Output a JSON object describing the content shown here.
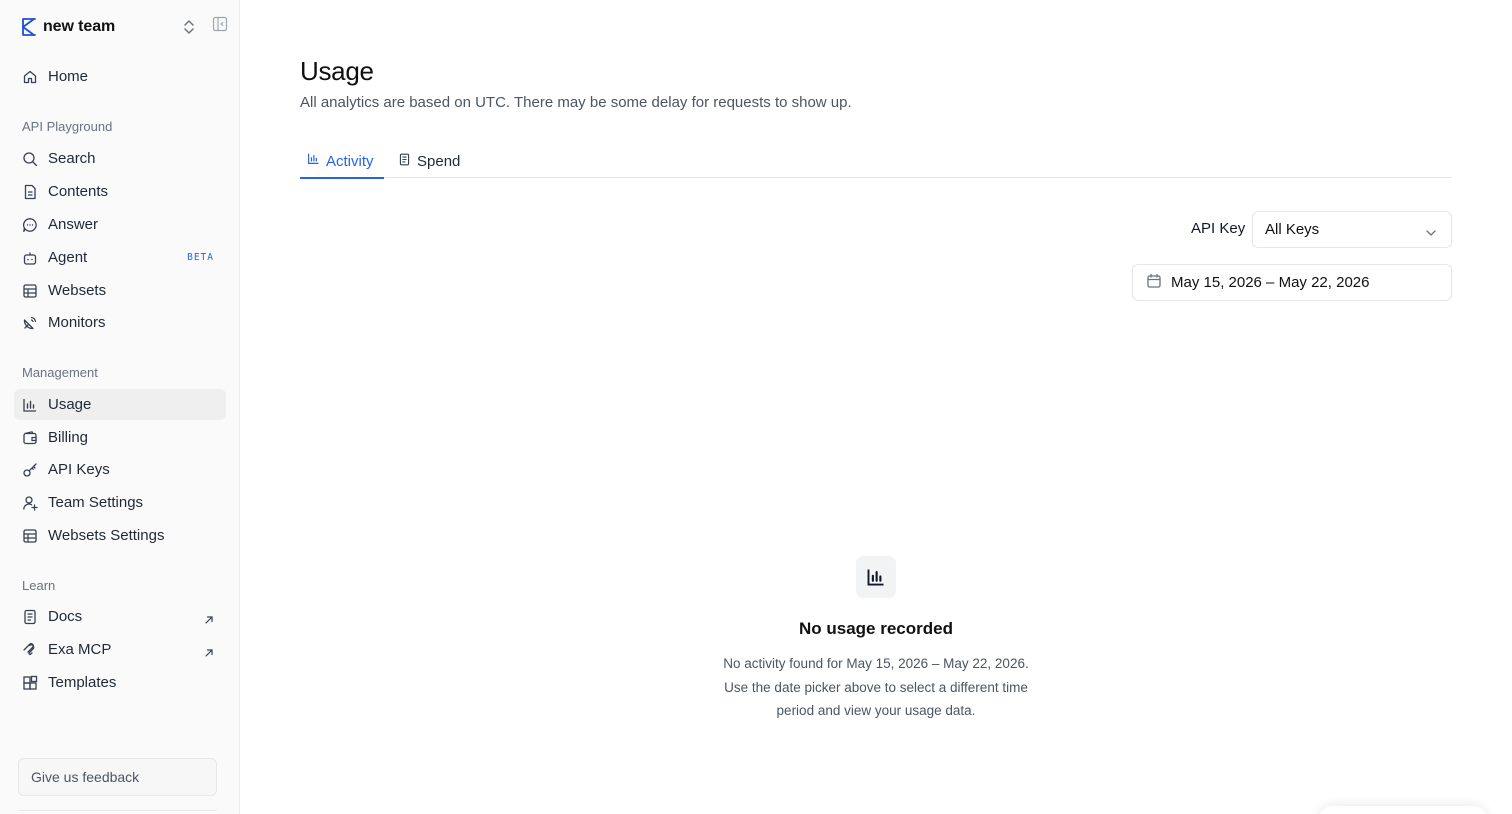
{
  "team": {
    "name": "new team"
  },
  "sidebar": {
    "home": {
      "label": "Home"
    },
    "sections": {
      "api_playground": "API Playground",
      "management": "Management",
      "learn": "Learn"
    },
    "api_items": [
      {
        "label": "Search"
      },
      {
        "label": "Contents"
      },
      {
        "label": "Answer"
      },
      {
        "label": "Agent",
        "badge": "BETA"
      },
      {
        "label": "Websets"
      },
      {
        "label": "Monitors"
      }
    ],
    "management_items": [
      {
        "label": "Usage",
        "active": true
      },
      {
        "label": "Billing"
      },
      {
        "label": "API Keys"
      },
      {
        "label": "Team Settings"
      },
      {
        "label": "Websets Settings"
      }
    ],
    "learn_items": [
      {
        "label": "Docs",
        "external": true
      },
      {
        "label": "Exa MCP",
        "external": true
      },
      {
        "label": "Templates"
      }
    ],
    "feedback_label": "Give us feedback"
  },
  "main": {
    "title": "Usage",
    "subtitle": "All analytics are based on UTC. There may be some delay for requests to show up.",
    "tabs": [
      {
        "label": "Activity",
        "active": true
      },
      {
        "label": "Spend",
        "active": false
      }
    ],
    "filters": {
      "api_key_label": "API Key",
      "api_key_value": "All Keys",
      "date_range": "May 15, 2026 – May 22, 2026"
    },
    "empty_state": {
      "title": "No usage recorded",
      "description": "No activity found for May 15, 2026 – May 22, 2026. Use the date picker above to select a different time period and view your usage data."
    }
  },
  "colors": {
    "accent": "#2563eb",
    "sidebar_bg": "#fafafa",
    "active_item_bg": "#efefef",
    "text": "#111827",
    "muted": "#6b7280"
  }
}
